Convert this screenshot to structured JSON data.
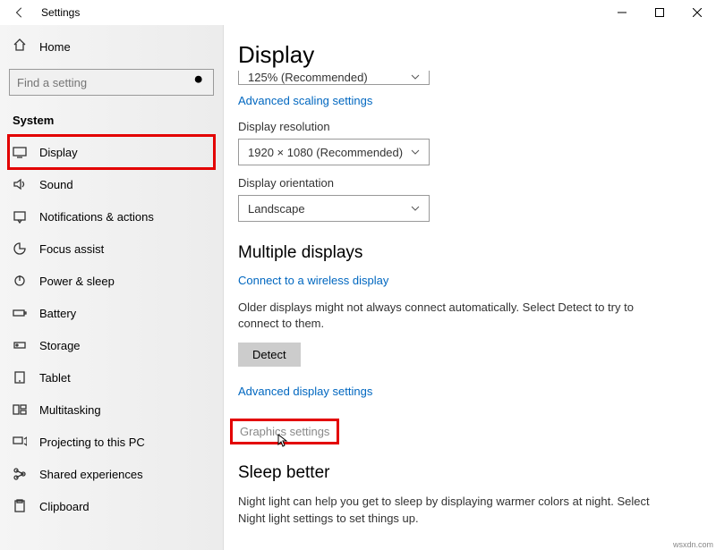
{
  "titlebar": {
    "title": "Settings"
  },
  "sidebar": {
    "home_label": "Home",
    "search_placeholder": "Find a setting",
    "section_label": "System",
    "items": [
      {
        "label": "Display"
      },
      {
        "label": "Sound"
      },
      {
        "label": "Notifications & actions"
      },
      {
        "label": "Focus assist"
      },
      {
        "label": "Power & sleep"
      },
      {
        "label": "Battery"
      },
      {
        "label": "Storage"
      },
      {
        "label": "Tablet"
      },
      {
        "label": "Multitasking"
      },
      {
        "label": "Projecting to this PC"
      },
      {
        "label": "Shared experiences"
      },
      {
        "label": "Clipboard"
      }
    ]
  },
  "main": {
    "page_title": "Display",
    "scale_value": "125% (Recommended)",
    "advanced_scaling": "Advanced scaling settings",
    "resolution_label": "Display resolution",
    "resolution_value": "1920 × 1080 (Recommended)",
    "orientation_label": "Display orientation",
    "orientation_value": "Landscape",
    "multiple_title": "Multiple displays",
    "connect_link": "Connect to a wireless display",
    "older_text": "Older displays might not always connect automatically. Select Detect to try to connect to them.",
    "detect_btn": "Detect",
    "advanced_display": "Advanced display settings",
    "graphics_link": "Graphics settings",
    "sleep_title": "Sleep better",
    "sleep_text": "Night light can help you get to sleep by displaying warmer colors at night. Select Night light settings to set things up."
  },
  "watermark": "wsxdn.com"
}
